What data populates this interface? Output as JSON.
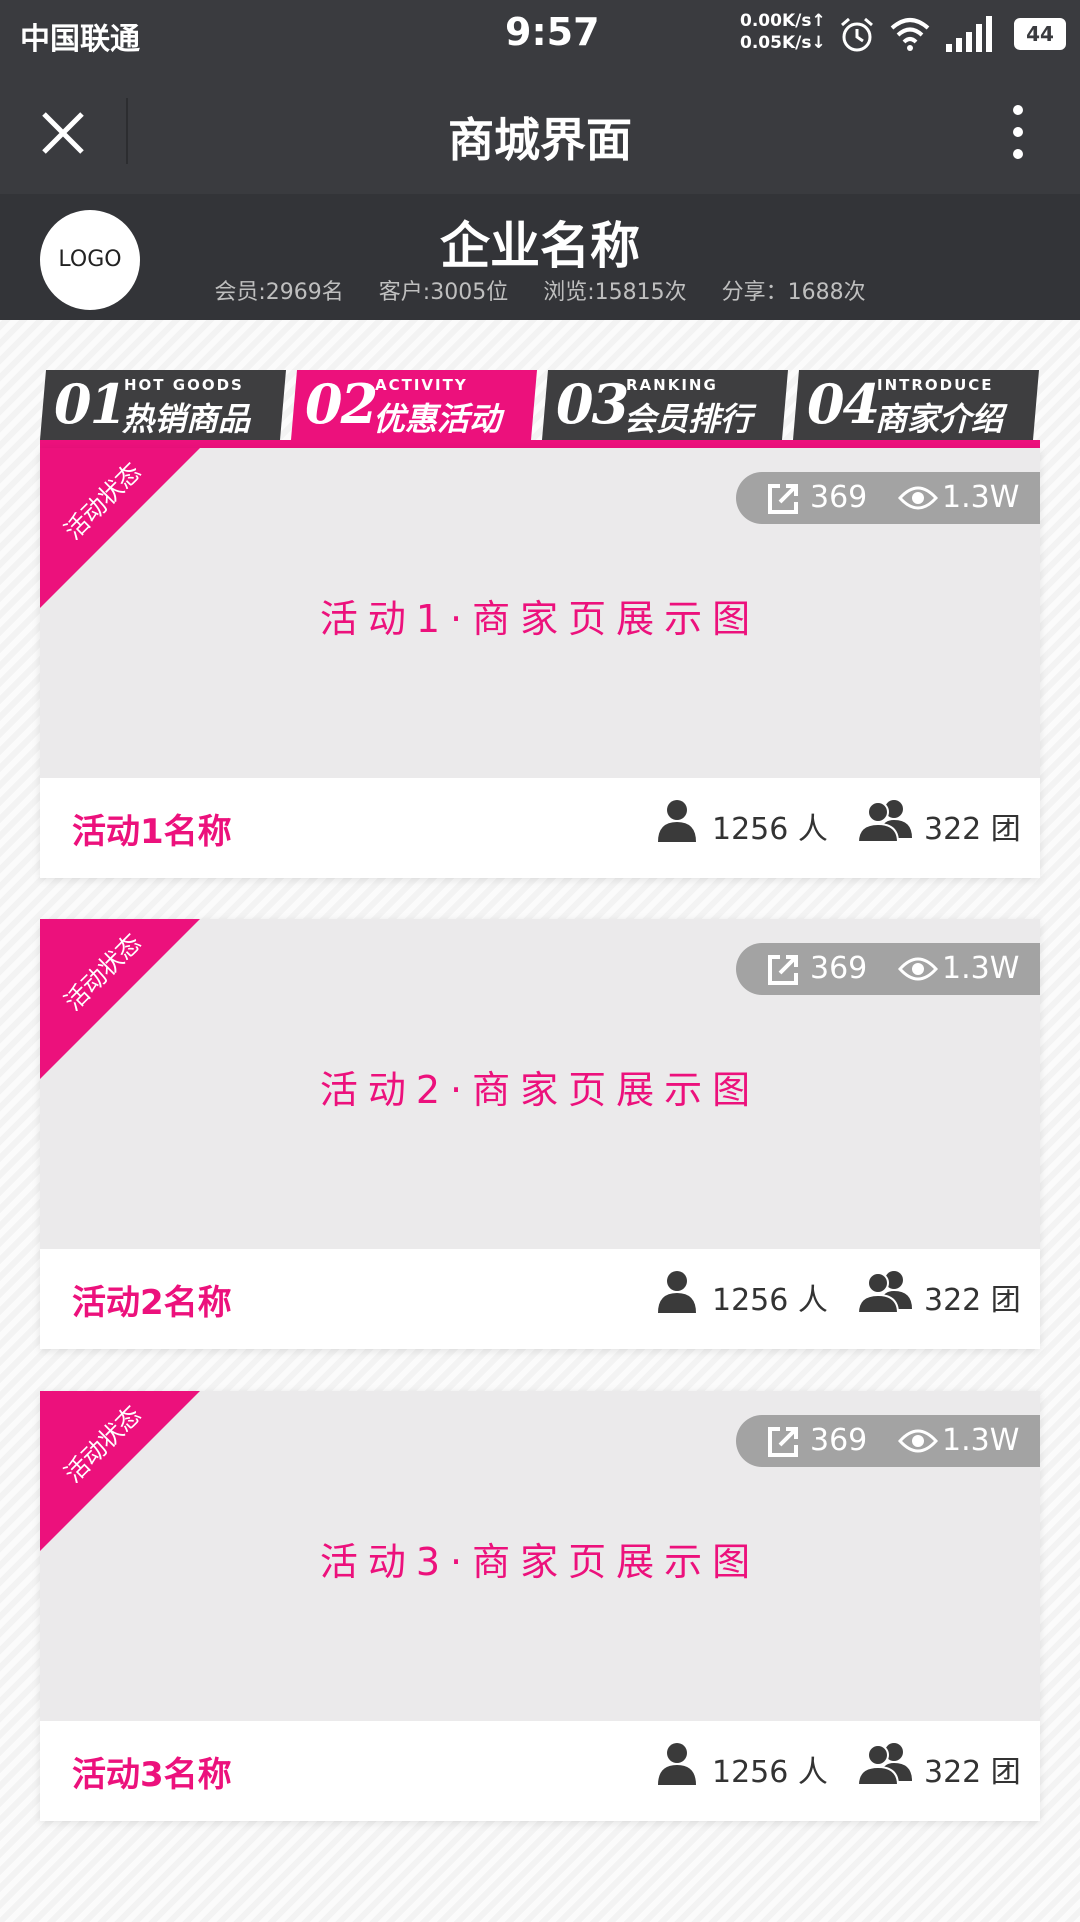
{
  "status_bar": {
    "carrier": "中国联通",
    "time": "9:57",
    "upload_speed": "0.00K/s↑",
    "download_speed": "0.05K/s↓",
    "battery": "44"
  },
  "title_bar": {
    "title": "商城界面"
  },
  "header": {
    "logo_text": "LOGO",
    "company_name": "企业名称",
    "members": "会员:2969名",
    "customers": "客户:3005位",
    "views": "浏览:15815次",
    "shares": "分享：1688次"
  },
  "tabs": [
    {
      "num": "01",
      "en": "HOT GOODS",
      "cn": "热销商品",
      "active": false
    },
    {
      "num": "02",
      "en": "ACTIVITY",
      "cn": "优惠活动",
      "active": true
    },
    {
      "num": "03",
      "en": "RANKING",
      "cn": "会员排行",
      "active": false
    },
    {
      "num": "04",
      "en": "INTRODUCE",
      "cn": "商家介绍",
      "active": false
    }
  ],
  "activities": [
    {
      "status": "活动状态",
      "shares": "369",
      "views": "1.3W",
      "caption": "活动1·商家页展示图",
      "name": "活动1名称",
      "people": "1256 人",
      "groups": "322 团"
    },
    {
      "status": "活动状态",
      "shares": "369",
      "views": "1.3W",
      "caption": "活动2·商家页展示图",
      "name": "活动2名称",
      "people": "1256 人",
      "groups": "322 团"
    },
    {
      "status": "活动状态",
      "shares": "369",
      "views": "1.3W",
      "caption": "活动3·商家页展示图",
      "name": "活动3名称",
      "people": "1256 人",
      "groups": "322 团"
    }
  ],
  "colors": {
    "accent": "#ec117c",
    "bar_dark": "#3a3b3f",
    "header_dark": "#333438",
    "tab_dark": "#3e3e40",
    "image_placeholder": "#ebeaeb",
    "pill_gray": "#a3a3a3"
  },
  "icons": [
    "close-icon",
    "more-icon",
    "alarm-icon",
    "wifi-icon",
    "signal-icon",
    "battery-icon",
    "share-icon",
    "eye-icon",
    "person-icon",
    "group-icon"
  ]
}
